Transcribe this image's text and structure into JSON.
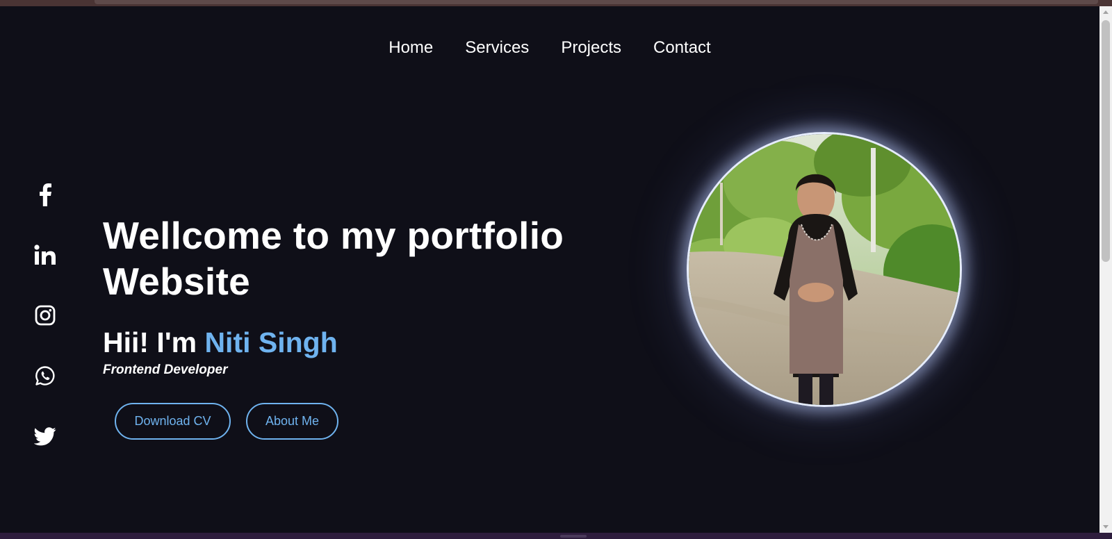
{
  "nav": {
    "items": [
      "Home",
      "Services",
      "Projects",
      "Contact"
    ]
  },
  "social": {
    "icons": [
      "facebook-icon",
      "linkedin-icon",
      "instagram-icon",
      "whatsapp-icon",
      "twitter-icon"
    ]
  },
  "hero": {
    "title_line1": "Wellcome to my portfolio",
    "title_line2": "Website",
    "greeting": "Hii! I'm ",
    "name": "Niti Singh",
    "role": "Frontend Developer",
    "buttons": {
      "download_cv": "Download CV",
      "about_me": "About Me"
    }
  },
  "colors": {
    "background": "#0f0f18",
    "accent": "#6fb3ef",
    "text": "#ffffff"
  }
}
